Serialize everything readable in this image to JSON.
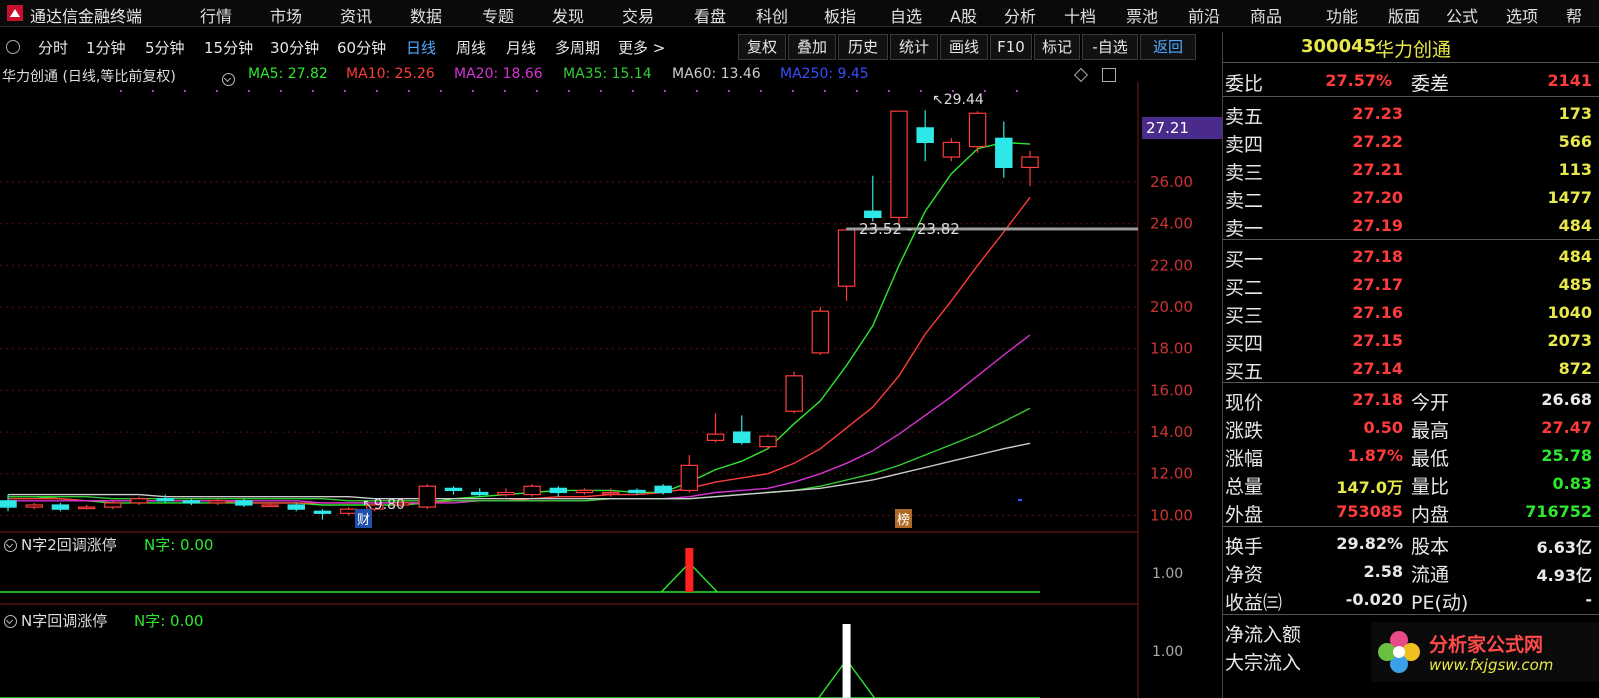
{
  "app": {
    "title": "通达信金融终端"
  },
  "menu": [
    "行情",
    "市场",
    "资讯",
    "数据",
    "专题",
    "发现",
    "交易",
    "看盘",
    "科创",
    "板指",
    "自选",
    "A股",
    "分析",
    "十档",
    "票池",
    "前沿",
    "商品",
    "功能",
    "版面",
    "公式",
    "选项",
    "帮"
  ],
  "toolbar": {
    "periods": [
      "分时",
      "1分钟",
      "5分钟",
      "15分钟",
      "30分钟",
      "60分钟",
      "日线",
      "周线",
      "月线",
      "多周期",
      "更多 >"
    ],
    "active_period": "日线",
    "buttons": [
      "复权",
      "叠加",
      "历史",
      "统计",
      "画线",
      "F10",
      "标记",
      "-自选",
      "返回"
    ]
  },
  "chart": {
    "title": "华力创通 (日线,等比前复权)",
    "ma": [
      {
        "name": "MA5",
        "value": "27.82",
        "color": "#2ee82e"
      },
      {
        "name": "MA10",
        "value": "25.26",
        "color": "#ff3b3b"
      },
      {
        "name": "MA20",
        "value": "18.66",
        "color": "#d633d6"
      },
      {
        "name": "MA35",
        "value": "15.14",
        "color": "#33cc33"
      },
      {
        "name": "MA60",
        "value": "13.46",
        "color": "#cccccc"
      },
      {
        "name": "MA250",
        "value": "9.45",
        "color": "#3a4dff"
      }
    ],
    "price_tag": "27.21",
    "annotations": {
      "high": "29.44",
      "low": "9.80",
      "range": "23.52 - 23.82",
      "tag_cai": "财",
      "tag_bang": "榜"
    }
  },
  "chart_data": {
    "type": "candlestick",
    "title": "华力创通 (日线,等比前复权)",
    "y_axis_ticks": [
      10.0,
      12.0,
      14.0,
      16.0,
      18.0,
      20.0,
      22.0,
      24.0,
      26.0
    ],
    "ylim": [
      9.3,
      30.8
    ],
    "candles": [
      {
        "o": 10.7,
        "c": 10.4,
        "h": 11.0,
        "l": 10.2
      },
      {
        "o": 10.4,
        "c": 10.5,
        "h": 10.6,
        "l": 10.3
      },
      {
        "o": 10.5,
        "c": 10.3,
        "h": 10.6,
        "l": 10.2
      },
      {
        "o": 10.4,
        "c": 10.4,
        "h": 10.5,
        "l": 10.3
      },
      {
        "o": 10.4,
        "c": 10.6,
        "h": 10.7,
        "l": 10.3
      },
      {
        "o": 10.6,
        "c": 10.8,
        "h": 10.9,
        "l": 10.5
      },
      {
        "o": 10.8,
        "c": 10.7,
        "h": 11.0,
        "l": 10.6
      },
      {
        "o": 10.7,
        "c": 10.6,
        "h": 10.8,
        "l": 10.5
      },
      {
        "o": 10.6,
        "c": 10.7,
        "h": 10.8,
        "l": 10.5
      },
      {
        "o": 10.7,
        "c": 10.5,
        "h": 10.8,
        "l": 10.4
      },
      {
        "o": 10.5,
        "c": 10.5,
        "h": 10.6,
        "l": 10.4
      },
      {
        "o": 10.5,
        "c": 10.3,
        "h": 10.6,
        "l": 10.2
      },
      {
        "o": 10.2,
        "c": 10.1,
        "h": 10.3,
        "l": 9.8
      },
      {
        "o": 10.1,
        "c": 10.3,
        "h": 10.4,
        "l": 10.0
      },
      {
        "o": 10.3,
        "c": 10.5,
        "h": 10.6,
        "l": 10.2
      },
      {
        "o": 10.5,
        "c": 10.6,
        "h": 10.7,
        "l": 10.4
      },
      {
        "o": 10.4,
        "c": 11.4,
        "h": 11.5,
        "l": 10.3
      },
      {
        "o": 11.3,
        "c": 11.2,
        "h": 11.4,
        "l": 11.0
      },
      {
        "o": 11.1,
        "c": 11.0,
        "h": 11.3,
        "l": 10.9
      },
      {
        "o": 11.0,
        "c": 11.1,
        "h": 11.3,
        "l": 10.9
      },
      {
        "o": 11.0,
        "c": 11.4,
        "h": 11.5,
        "l": 10.9
      },
      {
        "o": 11.3,
        "c": 11.1,
        "h": 11.4,
        "l": 10.9
      },
      {
        "o": 11.1,
        "c": 11.2,
        "h": 11.3,
        "l": 11.0
      },
      {
        "o": 11.1,
        "c": 11.1,
        "h": 11.3,
        "l": 10.9
      },
      {
        "o": 11.2,
        "c": 11.1,
        "h": 11.3,
        "l": 11.0
      },
      {
        "o": 11.4,
        "c": 11.1,
        "h": 11.5,
        "l": 11.0
      },
      {
        "o": 11.2,
        "c": 12.4,
        "h": 12.9,
        "l": 11.1
      },
      {
        "o": 13.6,
        "c": 13.9,
        "h": 14.9,
        "l": 13.5
      },
      {
        "o": 14.0,
        "c": 13.5,
        "h": 14.8,
        "l": 13.4
      },
      {
        "o": 13.3,
        "c": 13.8,
        "h": 13.9,
        "l": 13.2
      },
      {
        "o": 15.0,
        "c": 16.7,
        "h": 16.9,
        "l": 14.9
      },
      {
        "o": 17.8,
        "c": 19.8,
        "h": 20.0,
        "l": 17.7
      },
      {
        "o": 21.0,
        "c": 23.7,
        "h": 23.8,
        "l": 20.3
      },
      {
        "o": 24.6,
        "c": 24.3,
        "h": 26.3,
        "l": 24.1
      },
      {
        "o": 24.3,
        "c": 29.4,
        "h": 29.4,
        "l": 23.9
      },
      {
        "o": 28.6,
        "c": 27.9,
        "h": 29.44,
        "l": 27.0
      },
      {
        "o": 27.2,
        "c": 27.9,
        "h": 28.1,
        "l": 27.0
      },
      {
        "o": 27.7,
        "c": 29.3,
        "h": 29.4,
        "l": 27.4
      },
      {
        "o": 28.1,
        "c": 26.7,
        "h": 28.9,
        "l": 26.2
      },
      {
        "o": 26.7,
        "c": 27.2,
        "h": 27.5,
        "l": 25.8
      }
    ],
    "ma_series": [
      {
        "name": "MA5",
        "color": "#2ee82e",
        "values": [
          10.9,
          10.9,
          10.8,
          10.7,
          10.6,
          10.6,
          10.6,
          10.6,
          10.6,
          10.6,
          10.6,
          10.6,
          10.5,
          10.5,
          10.5,
          10.5,
          10.6,
          10.8,
          10.9,
          11.0,
          11.1,
          11.2,
          11.2,
          11.2,
          11.1,
          11.1,
          11.6,
          12.2,
          12.6,
          13.2,
          14.4,
          15.5,
          17.2,
          19.1,
          22.0,
          24.6,
          26.4,
          27.6,
          27.9,
          27.82
        ]
      },
      {
        "name": "MA10",
        "color": "#ff3b3b",
        "values": [
          10.8,
          10.8,
          10.8,
          10.7,
          10.7,
          10.7,
          10.7,
          10.7,
          10.7,
          10.6,
          10.6,
          10.6,
          10.6,
          10.6,
          10.6,
          10.6,
          10.6,
          10.7,
          10.7,
          10.7,
          10.8,
          10.9,
          10.9,
          11.0,
          11.0,
          11.1,
          11.3,
          11.6,
          11.8,
          12.0,
          12.5,
          13.2,
          14.2,
          15.2,
          16.7,
          18.7,
          20.3,
          22.0,
          23.6,
          25.26
        ]
      },
      {
        "name": "MA20",
        "color": "#d633d6",
        "values": [
          10.7,
          10.7,
          10.7,
          10.7,
          10.7,
          10.7,
          10.7,
          10.7,
          10.7,
          10.7,
          10.7,
          10.7,
          10.6,
          10.6,
          10.6,
          10.6,
          10.6,
          10.6,
          10.7,
          10.7,
          10.7,
          10.7,
          10.7,
          10.8,
          10.8,
          10.8,
          10.9,
          11.1,
          11.2,
          11.3,
          11.6,
          12.0,
          12.5,
          13.1,
          13.9,
          14.8,
          15.7,
          16.7,
          17.7,
          18.66
        ]
      },
      {
        "name": "MA35",
        "color": "#33cc33",
        "values": [
          10.9,
          10.9,
          10.9,
          10.9,
          10.8,
          10.8,
          10.8,
          10.8,
          10.8,
          10.8,
          10.8,
          10.8,
          10.8,
          10.7,
          10.7,
          10.7,
          10.7,
          10.7,
          10.7,
          10.7,
          10.7,
          10.7,
          10.7,
          10.8,
          10.8,
          10.8,
          10.8,
          10.9,
          11.0,
          11.1,
          11.2,
          11.4,
          11.7,
          12.0,
          12.4,
          12.9,
          13.4,
          13.9,
          14.5,
          15.14
        ]
      },
      {
        "name": "MA60",
        "color": "#cccccc",
        "values": [
          11.0,
          11.0,
          11.0,
          11.0,
          11.0,
          11.0,
          10.9,
          10.9,
          10.9,
          10.9,
          10.9,
          10.9,
          10.9,
          10.9,
          10.8,
          10.8,
          10.8,
          10.8,
          10.8,
          10.8,
          10.8,
          10.8,
          10.8,
          10.8,
          10.8,
          10.8,
          10.8,
          10.9,
          11.0,
          11.1,
          11.2,
          11.3,
          11.5,
          11.7,
          12.0,
          12.3,
          12.6,
          12.9,
          13.2,
          13.46
        ]
      }
    ],
    "indicators": [
      {
        "name": "N字2回调涨停",
        "series": "N字",
        "value": 0.0,
        "signal_index": 26,
        "signal_color": "#ff2020",
        "axis_tick": 1.0
      },
      {
        "name": "N字回调涨停",
        "series": "N字",
        "value": 0.0,
        "signal_index": 32,
        "signal_color": "#ffffff",
        "axis_tick": 1.0
      }
    ]
  },
  "indicator_panels": {
    "p1": {
      "label": "N字2回调涨停",
      "series": "N字: 0.00",
      "tick": "1.00"
    },
    "p2": {
      "label": "N字回调涨停",
      "series": "N字: 0.00",
      "tick": "1.00"
    }
  },
  "quote": {
    "code": "300045",
    "name": "华力创通",
    "weibi_label": "委比",
    "weibi": "27.57%",
    "weicha_label": "委差",
    "weicha": "2141",
    "asks": [
      {
        "label": "卖五",
        "price": "27.23",
        "vol": "173"
      },
      {
        "label": "卖四",
        "price": "27.22",
        "vol": "566"
      },
      {
        "label": "卖三",
        "price": "27.21",
        "vol": "113"
      },
      {
        "label": "卖二",
        "price": "27.20",
        "vol": "1477"
      },
      {
        "label": "卖一",
        "price": "27.19",
        "vol": "484"
      }
    ],
    "bids": [
      {
        "label": "买一",
        "price": "27.18",
        "vol": "484"
      },
      {
        "label": "买二",
        "price": "27.17",
        "vol": "485"
      },
      {
        "label": "买三",
        "price": "27.16",
        "vol": "1040"
      },
      {
        "label": "买四",
        "price": "27.15",
        "vol": "2073"
      },
      {
        "label": "买五",
        "price": "27.14",
        "vol": "872"
      }
    ],
    "stats": [
      {
        "l1": "现价",
        "v1": "27.18",
        "c1": "#ff3b3b",
        "l2": "今开",
        "v2": "26.68",
        "c2": "#e8e8e8"
      },
      {
        "l1": "涨跌",
        "v1": "0.50",
        "c1": "#ff3b3b",
        "l2": "最高",
        "v2": "27.47",
        "c2": "#ff3b3b"
      },
      {
        "l1": "涨幅",
        "v1": "1.87%",
        "c1": "#ff3b3b",
        "l2": "最低",
        "v2": "25.78",
        "c2": "#2ee82e"
      },
      {
        "l1": "总量",
        "v1": "147.0万",
        "c1": "#e8e84a",
        "l2": "量比",
        "v2": "0.83",
        "c2": "#2ee82e"
      },
      {
        "l1": "外盘",
        "v1": "753085",
        "c1": "#ff3b3b",
        "l2": "内盘",
        "v2": "716752",
        "c2": "#2ee82e"
      }
    ],
    "stats2": [
      {
        "l1": "换手",
        "v1": "29.82%",
        "c1": "#e8e8e8",
        "l2": "股本",
        "v2": "6.63亿",
        "c2": "#e8e8e8"
      },
      {
        "l1": "净资",
        "v1": "2.58",
        "c1": "#e8e8e8",
        "l2": "流通",
        "v2": "4.93亿",
        "c2": "#e8e8e8"
      },
      {
        "l1": "收益㈢",
        "v1": "-0.020",
        "c1": "#e8e8e8",
        "l2": "PE(动)",
        "v2": "-",
        "c2": "#e8e8e8"
      }
    ],
    "flows": [
      "净流入额",
      "大宗流入"
    ],
    "watermark": {
      "name": "分析家公式网",
      "url": "www.fxjgsw.com"
    }
  }
}
